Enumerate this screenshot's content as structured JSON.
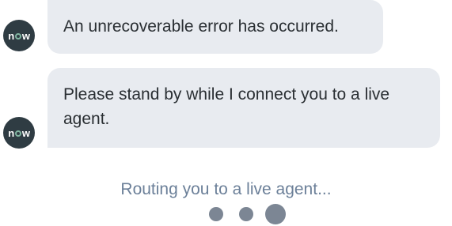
{
  "bot": {
    "avatar_text": "now"
  },
  "messages": [
    {
      "text": "An unrecoverable error has occurred."
    },
    {
      "text": "Please stand by while I connect you to a live agent."
    }
  ],
  "status": {
    "text": "Routing you to a live agent..."
  },
  "colors": {
    "bubble_bg": "#e8ebf0",
    "avatar_bg": "#2f3c43",
    "logo_accent": "#81b5a1",
    "status_text": "#6c8099",
    "dot": "#7c8694"
  }
}
